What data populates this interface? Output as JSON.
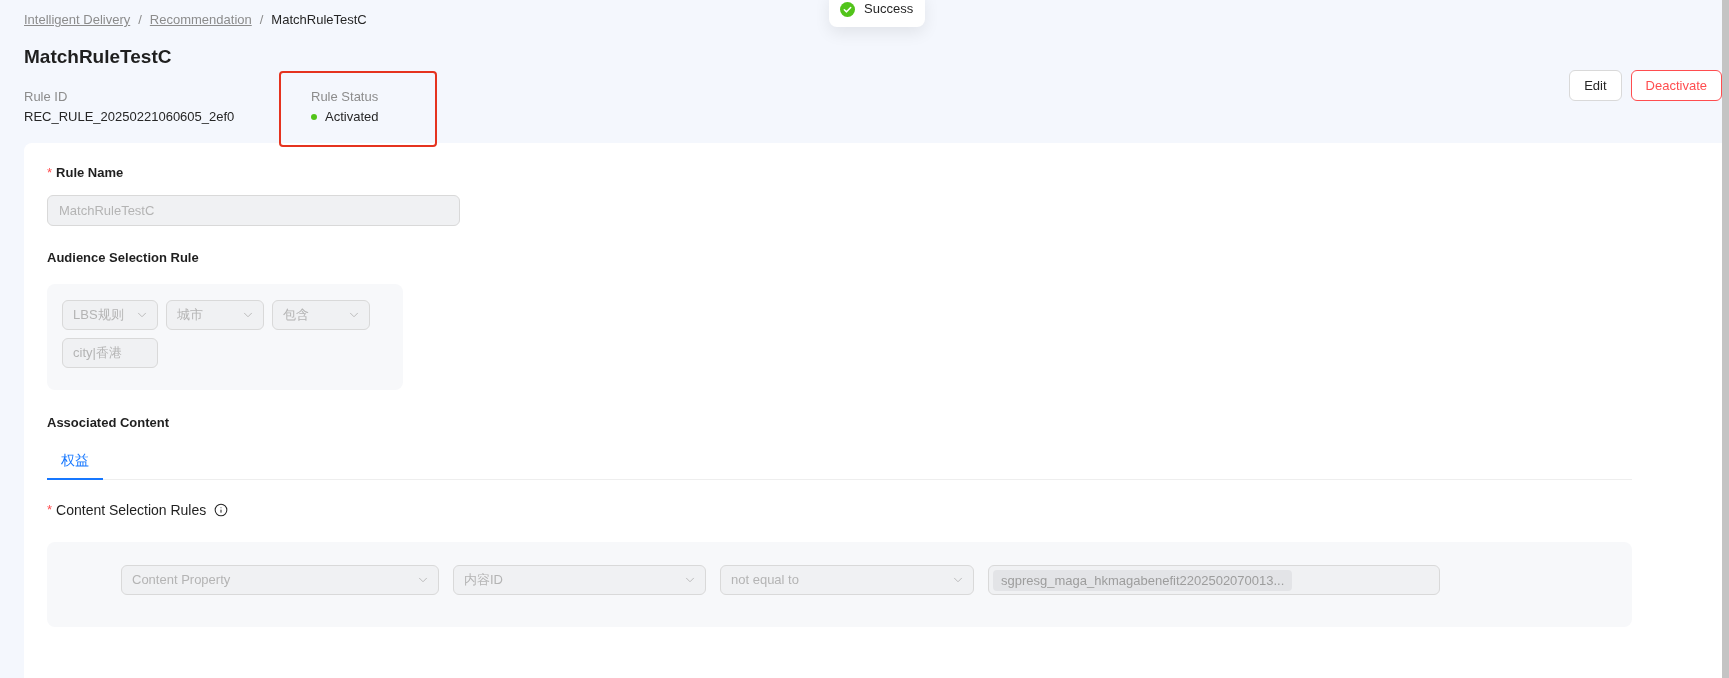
{
  "toast": {
    "kind": "success",
    "message": "Success"
  },
  "breadcrumb": [
    {
      "label": "Intelligent Delivery",
      "kind": "link"
    },
    {
      "label": "Recommendation",
      "kind": "link",
      "separator": "/"
    },
    {
      "label": "MatchRuleTestC",
      "kind": "current",
      "separator": "/"
    }
  ],
  "header": {
    "title": "MatchRuleTestC",
    "actions": [
      {
        "label": "Edit",
        "kind": "default"
      },
      {
        "label": "Deactivate",
        "kind": "danger"
      }
    ]
  },
  "info": [
    {
      "kind": "text",
      "label": "Rule ID",
      "value": "REC_RULE_20250221060605_2ef0"
    },
    {
      "kind": "status",
      "label": "Rule Status",
      "value": "Activated",
      "color": "#52c41a",
      "highlighted": true
    }
  ],
  "form": {
    "disabled": true,
    "rule_name": {
      "required_mark": "*",
      "label": "Rule Name",
      "value": "MatchRuleTestC"
    },
    "audience": {
      "label": "Audience Selection Rule",
      "fields": [
        {
          "kind": "select",
          "value": "LBS规则"
        },
        {
          "kind": "select",
          "value": "城市"
        },
        {
          "kind": "select",
          "value": "包含"
        },
        {
          "kind": "input",
          "value": "city|香港"
        }
      ]
    },
    "associated": {
      "label": "Associated Content",
      "tabs": [
        {
          "label": "权益",
          "selected": true
        }
      ]
    },
    "content_rules": {
      "required_mark": "*",
      "label": "Content Selection Rules",
      "fields": [
        {
          "kind": "select",
          "value": "Content Property"
        },
        {
          "kind": "select",
          "value": "内容ID"
        },
        {
          "kind": "select",
          "value": "not equal to"
        },
        {
          "kind": "tags",
          "tags": [
            "sgpresg_maga_hkmagabenefit2202502070013..."
          ]
        }
      ]
    }
  }
}
